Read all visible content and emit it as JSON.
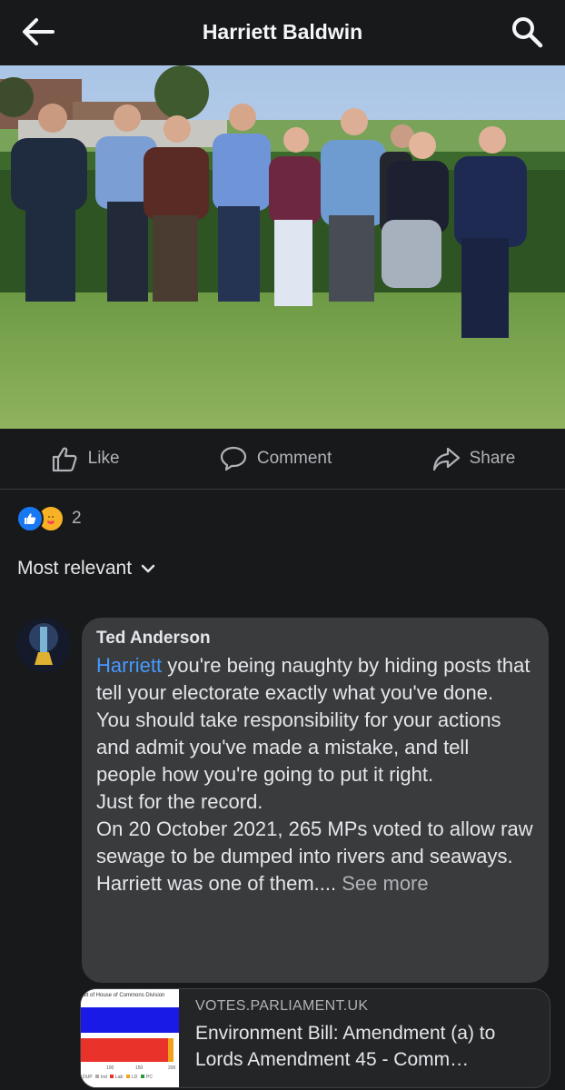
{
  "header": {
    "title": "Harriett Baldwin",
    "back_icon": "arrow-left-icon",
    "search_icon": "search-icon"
  },
  "actions": {
    "like": "Like",
    "comment": "Comment",
    "share": "Share"
  },
  "reactions": {
    "count": "2",
    "types": [
      "like",
      "care"
    ]
  },
  "sort": {
    "label": "Most relevant"
  },
  "comment": {
    "author": "Ted Anderson",
    "mention": "Harriett",
    "line1_rest": " you're being naughty by hiding posts that tell your electorate exactly what you've done.",
    "para2": "You should take responsibility for your actions and admit you've made a mistake, and tell people how you're going to put it right.",
    "para3": "Just for the record.",
    "para4": "On 20 October 2021, 265 MPs voted to allow raw sewage to be dumped into rivers and seaways.",
    "para5": "Harriett was one of them.... ",
    "see_more": "See more"
  },
  "link": {
    "domain": "VOTES.PARLIAMENT.UK",
    "title": "Environment Bill: Amendment (a) to Lords Amendment 45 - Comm…",
    "thumb": {
      "caption": "ult of House of Commons Division",
      "ticks": [
        "100",
        "150",
        "200"
      ],
      "legend": [
        "DUP",
        "Ind",
        "Lab",
        "LD",
        "PC"
      ]
    }
  },
  "colors": {
    "accent": "#4599ff",
    "background": "#18191a",
    "bubble": "#3a3b3c"
  }
}
